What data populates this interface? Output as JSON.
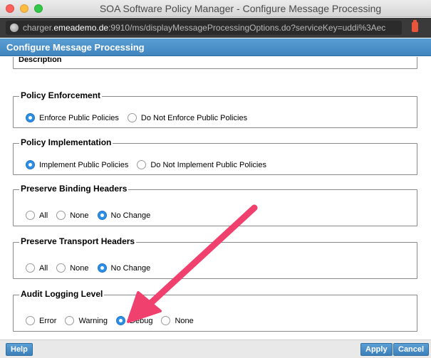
{
  "window": {
    "title": "SOA Software Policy Manager - Configure Message Processing"
  },
  "urlbar": {
    "url_prefix": "charger.",
    "url_host": "emeademo.de",
    "url_rest": ":9910/ms/displayMessageProcessingOptions.do?serviceKey=uddi%3Aec"
  },
  "dialog": {
    "title": "Configure Message Processing"
  },
  "sections": {
    "description": {
      "label": "Description"
    },
    "policy_enforcement": {
      "legend": "Policy Enforcement",
      "options": [
        "Enforce Public Policies",
        "Do Not Enforce Public Policies"
      ],
      "selected": "Enforce Public Policies"
    },
    "policy_implementation": {
      "legend": "Policy Implementation",
      "options": [
        "Implement Public Policies",
        "Do Not Implement Public Policies"
      ],
      "selected": "Implement Public Policies"
    },
    "preserve_binding_headers": {
      "legend": "Preserve Binding Headers",
      "options": [
        "All",
        "None",
        "No Change"
      ],
      "selected": "No Change"
    },
    "preserve_transport_headers": {
      "legend": "Preserve Transport Headers",
      "options": [
        "All",
        "None",
        "No Change"
      ],
      "selected": "No Change"
    },
    "audit_logging_level": {
      "legend": "Audit Logging Level",
      "options": [
        "Error",
        "Warning",
        "Debug",
        "None"
      ],
      "selected": "Debug"
    }
  },
  "footer": {
    "help_label": "Help",
    "apply_label": "Apply",
    "cancel_label": "Cancel"
  },
  "colors": {
    "header_blue": "#4a8fc8",
    "radio_selected": "#2b8ee7",
    "annotation_arrow": "#f0406e"
  }
}
